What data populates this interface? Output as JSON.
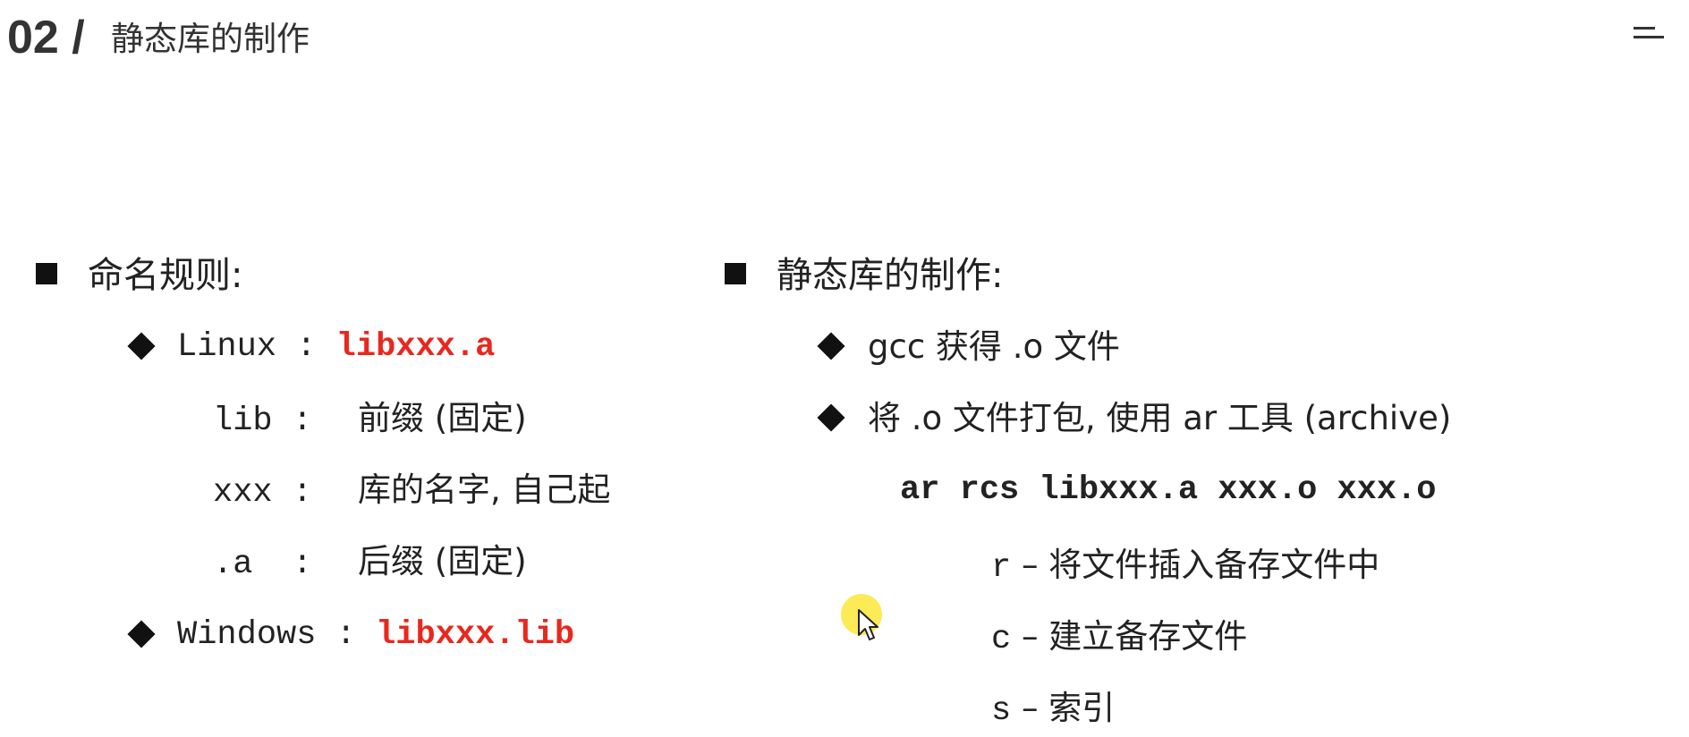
{
  "header": {
    "number": "02 /",
    "title": "静态库的制作"
  },
  "left": {
    "heading": "命名规则:",
    "linux": {
      "label": "Linux :",
      "value": "libxxx.a"
    },
    "details": [
      {
        "key": "lib :",
        "desc": "前缀 (固定)"
      },
      {
        "key": "xxx :",
        "desc": "库的名字, 自己起"
      },
      {
        "key": ".a  :",
        "desc": "后缀 (固定)"
      }
    ],
    "windows": {
      "label": "Windows :",
      "value": "libxxx.lib"
    }
  },
  "right": {
    "heading": "静态库的制作:",
    "step1": "gcc 获得 .o 文件",
    "step2": "将 .o 文件打包, 使用 ar 工具 (archive)",
    "command": "ar rcs libxxx.a xxx.o xxx.o",
    "options": [
      {
        "flag": "r",
        "dash": "–",
        "desc": "将文件插入备存文件中"
      },
      {
        "flag": "c",
        "dash": "–",
        "desc": "建立备存文件"
      },
      {
        "flag": "s",
        "dash": "–",
        "desc": "索引"
      }
    ]
  },
  "icons": [
    "menu-icon",
    "square-bullet-icon",
    "diamond-bullet-icon",
    "mouse-cursor-icon"
  ],
  "colors": {
    "accent_red": "#e8281e",
    "text": "#222222",
    "cursor_highlight": "#fbe63a"
  }
}
